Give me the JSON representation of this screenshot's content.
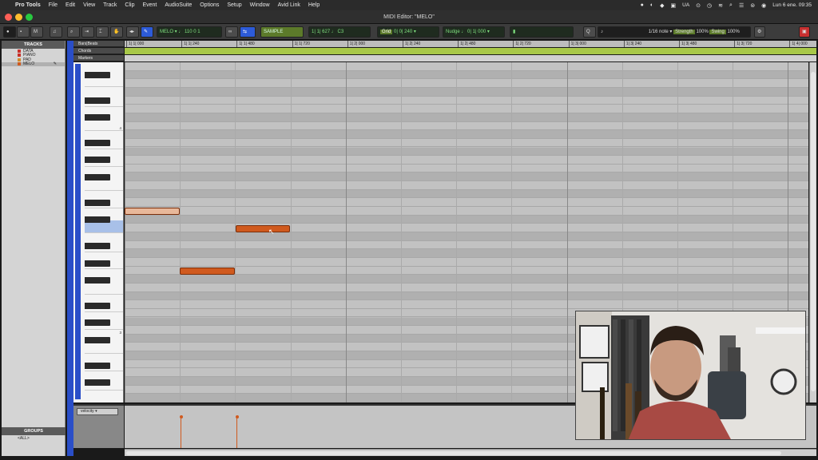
{
  "menubar": {
    "items": [
      "Pro Tools",
      "File",
      "Edit",
      "View",
      "Track",
      "Clip",
      "Event",
      "AudioSuite",
      "Options",
      "Setup",
      "Window",
      "Avid Link",
      "Help"
    ],
    "input_source": "UA",
    "clock": "Lun 6 ene.  09:35"
  },
  "window": {
    "title": "MIDI Editor: \"MELO\""
  },
  "toolbar": {
    "track_name": "MELO",
    "track_value": "110 0 1",
    "counter_mode": "SAMPLE",
    "counter_value": "1| 1| 627",
    "note_value": "C3",
    "grid_label": "Grid",
    "grid_value": "0| 0| 240",
    "nudge_label": "Nudge",
    "nudge_value": "0| 1| 000",
    "quantize_value": "1/16 note",
    "strength_label": "Strength",
    "strength_value": "100%",
    "swing_label": "Swing",
    "swing_value": "100%"
  },
  "tracks_panel": {
    "title": "TRACKS",
    "tracks": [
      {
        "name": "DATA",
        "color": "#c8302a"
      },
      {
        "name": "PIANO",
        "color": "#c8302a"
      },
      {
        "name": "PAD",
        "color": "#d08a2a"
      },
      {
        "name": "MELO",
        "color": "#d05a1e"
      }
    ],
    "groups_title": "GROUPS",
    "groups_item": "<ALL>"
  },
  "rulers": {
    "bars_beats_label": "Bars|Beats",
    "chords_label": "Chords",
    "markers_label": "Markers",
    "ticks": [
      "1| 1| 000",
      "1| 1| 240",
      "1| 1| 480",
      "1| 1| 720",
      "1| 2| 000",
      "1| 2| 240",
      "1| 2| 480",
      "1| 2| 720",
      "1| 3| 000",
      "1| 3| 240",
      "1| 3| 480",
      "1| 3| 720",
      "1| 4| 000"
    ]
  },
  "piano": {
    "octave_labels": [
      "4",
      "3"
    ]
  },
  "velocity": {
    "lane_label": "velocity",
    "values": [
      127,
      127
    ]
  },
  "notes": [
    {
      "pitch": "C4",
      "start": "1|1|000",
      "length_ticks": 240,
      "state": "selected"
    },
    {
      "pitch": "A3",
      "start": "1|1|480",
      "length_ticks": 240,
      "state": "normal"
    },
    {
      "pitch": "F3",
      "start": "1|1|240",
      "length_ticks": 240,
      "state": "normal"
    }
  ],
  "colors": {
    "accent_blue": "#2a4ec8",
    "note_orange": "#d05a1e",
    "note_selected": "#e8b89a",
    "chords_ruler": "#a8c848"
  }
}
